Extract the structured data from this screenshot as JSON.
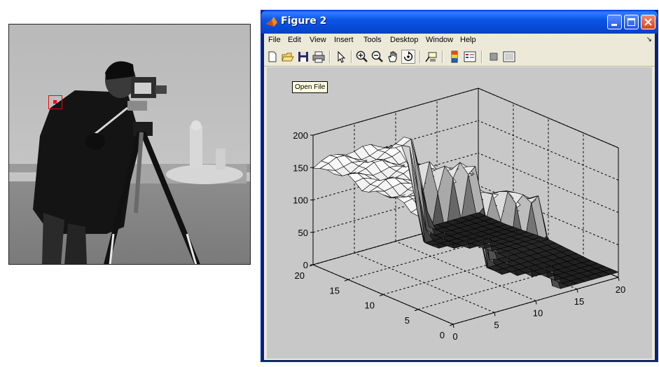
{
  "window": {
    "title": "Figure 2",
    "title_bar_color": "#0b56e6"
  },
  "menu": {
    "items": [
      "File",
      "Edit",
      "View",
      "Insert",
      "Tools",
      "Desktop",
      "Window",
      "Help"
    ]
  },
  "toolbar": {
    "buttons": [
      "new-figure-icon",
      "open-file-icon",
      "save-icon",
      "print-icon",
      "pointer-icon",
      "zoom-in-icon",
      "zoom-out-icon",
      "pan-hand-icon",
      "rotate-3d-icon",
      "data-cursor-icon",
      "colorbar-icon",
      "legend-icon",
      "hide-plot-tools-icon",
      "show-plot-tools-icon"
    ]
  },
  "tooltip": {
    "text": "Open File"
  },
  "chart_data": {
    "type": "surface",
    "z_ticks": [
      "0",
      "50",
      "100",
      "150",
      "200"
    ],
    "x_ticks": [
      "0",
      "5",
      "10",
      "15",
      "20"
    ],
    "y_ticks": [
      "0",
      "5",
      "10",
      "15",
      "20"
    ],
    "zlim": [
      0,
      200
    ],
    "xlim": [
      0,
      20
    ],
    "ylim": [
      0,
      20
    ],
    "grid": true,
    "description_values": {
      "plateau_height_approx": 160,
      "floor_height_approx": 10
    }
  },
  "image": {
    "marker_color": "#ff0000"
  }
}
